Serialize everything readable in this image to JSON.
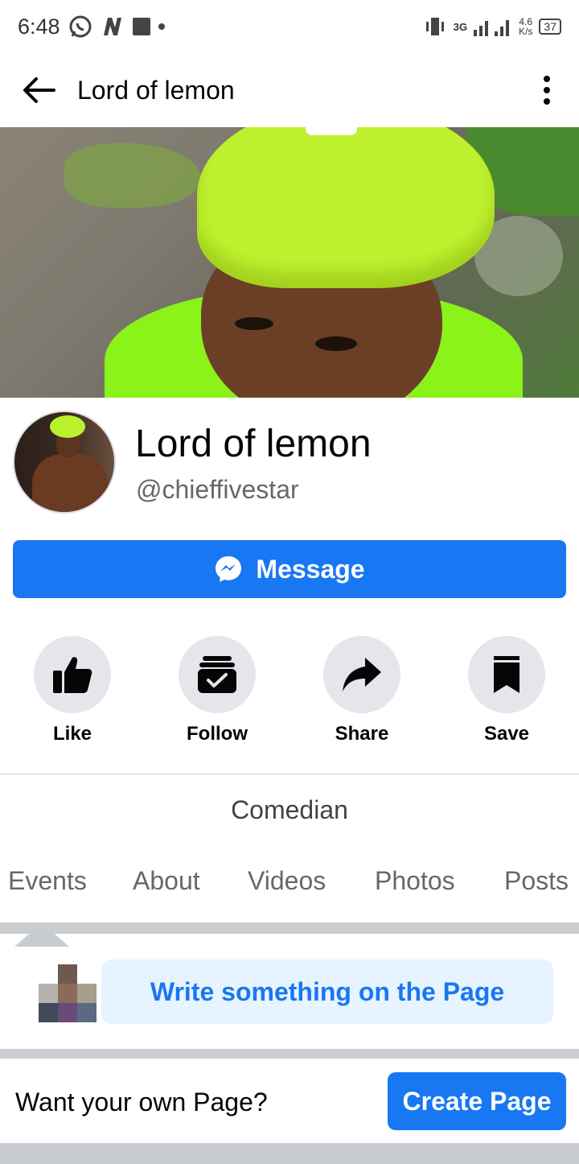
{
  "status_bar": {
    "time": "6:48",
    "net_speed_value": "4.6",
    "net_speed_unit": "K/s",
    "network_type": "3G",
    "battery": "37",
    "icons": [
      "whatsapp-icon",
      "n-app-icon",
      "square-notification-icon",
      "dot-icon",
      "vibrate-icon",
      "signal-icon"
    ]
  },
  "topnav": {
    "title": "Lord of lemon",
    "back_icon": "arrow-left-icon",
    "more_icon": "more-vertical-icon"
  },
  "profile": {
    "name": "Lord of lemon",
    "handle": "@chieffivestar"
  },
  "message_button": {
    "label": "Message",
    "icon": "messenger-icon"
  },
  "actions": [
    {
      "label": "Like",
      "icon": "thumbs-up-icon"
    },
    {
      "label": "Follow",
      "icon": "follow-check-icon"
    },
    {
      "label": "Share",
      "icon": "share-arrow-icon"
    },
    {
      "label": "Save",
      "icon": "bookmark-icon"
    }
  ],
  "category": "Comedian",
  "tabs": [
    "Events",
    "About",
    "Videos",
    "Photos",
    "Posts"
  ],
  "composer": {
    "placeholder": "Write something on the Page"
  },
  "footer": {
    "prompt": "Want your own Page?",
    "button_label": "Create Page"
  },
  "colors": {
    "accent": "#1877f2",
    "action_circle": "#e4e6eb",
    "composer_bg": "#e7f3ff",
    "band_grey": "#c9ccd1"
  }
}
